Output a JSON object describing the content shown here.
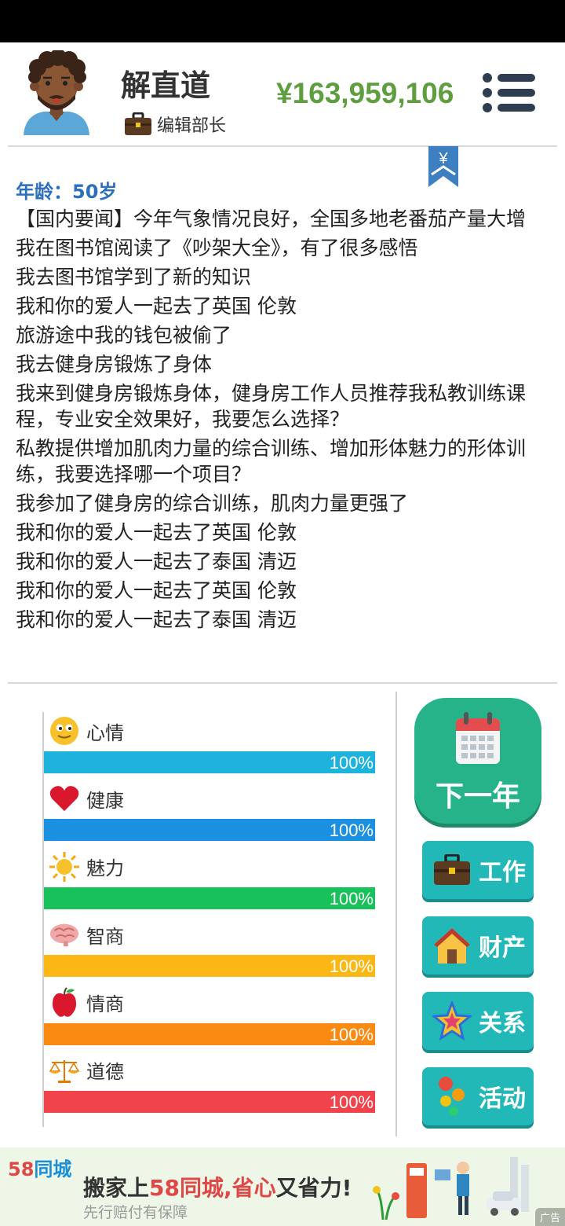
{
  "header": {
    "name": "解直道",
    "job_title": "编辑部长",
    "money": "¥163,959,106"
  },
  "bookmark_symbol": "¥",
  "age_label": "年龄：50岁",
  "log": [
    "【国内要闻】今年气象情况良好，全国多地老番茄产量大增",
    "我在图书馆阅读了《吵架大全》，有了很多感悟",
    "我去图书馆学到了新的知识",
    "我和你的爱人一起去了英国 伦敦",
    "旅游途中我的钱包被偷了",
    "我去健身房锻炼了身体",
    "我来到健身房锻炼身体，健身房工作人员推荐我私教训练课程，专业安全效果好，我要怎么选择？",
    "私教提供增加肌肉力量的综合训练、增加形体魅力的形体训练，我要选择哪一个项目？",
    "我参加了健身房的综合训练，肌肉力量更强了",
    "我和你的爱人一起去了英国 伦敦",
    "我和你的爱人一起去了泰国 清迈",
    "我和你的爱人一起去了英国 伦敦",
    "我和你的爱人一起去了泰国 清迈"
  ],
  "stats": [
    {
      "label": "心情",
      "value": 1.0,
      "text": "100%",
      "color": "#1eb3dc",
      "icon": "smiley-icon"
    },
    {
      "label": "健康",
      "value": 1.0,
      "text": "100%",
      "color": "#1b8fe0",
      "icon": "heart-icon"
    },
    {
      "label": "魅力",
      "value": 1.0,
      "text": "100%",
      "color": "#19c15a",
      "icon": "sun-icon"
    },
    {
      "label": "智商",
      "value": 1.0,
      "text": "100%",
      "color": "#fbb713",
      "icon": "brain-icon"
    },
    {
      "label": "情商",
      "value": 1.0,
      "text": "100%",
      "color": "#fb8a12",
      "icon": "apple-icon"
    },
    {
      "label": "道德",
      "value": 1.0,
      "text": "100%",
      "color": "#f0434b",
      "icon": "scales-icon"
    }
  ],
  "buttons": {
    "next_year": "下一年",
    "work": "工作",
    "property": "财产",
    "relations": "关系",
    "activities": "活动"
  },
  "ad": {
    "brand_num": "58",
    "brand_name": "同城",
    "headline_a": "搬家上",
    "headline_hl": "58同城,省心",
    "headline_b": "又省力!",
    "sub": "先行赔付有保障",
    "tag": "广告"
  }
}
